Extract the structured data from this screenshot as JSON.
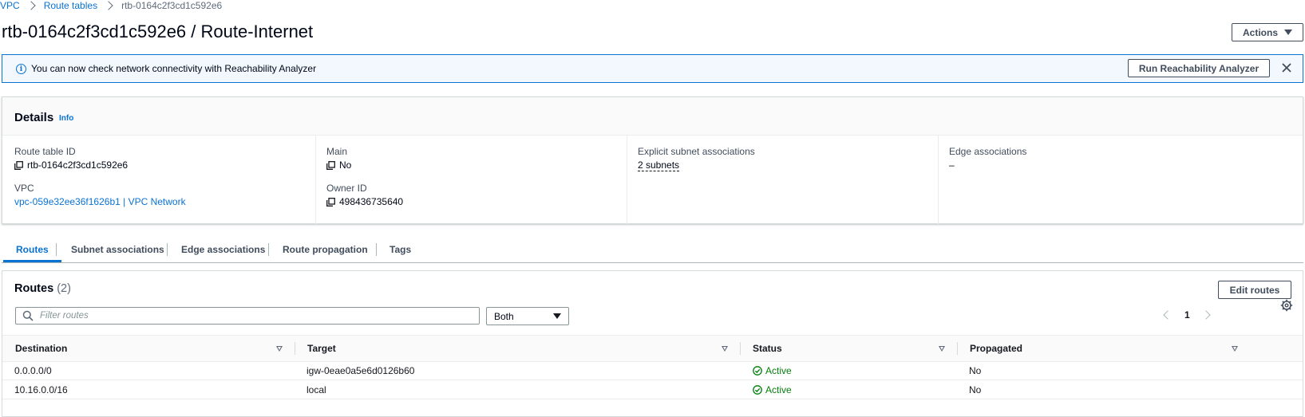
{
  "breadcrumb": {
    "items": [
      "VPC",
      "Route tables"
    ],
    "current": "rtb-0164c2f3cd1c592e6"
  },
  "page": {
    "title": "rtb-0164c2f3cd1c592e6 / Route-Internet",
    "actions_label": "Actions"
  },
  "alert": {
    "message": "You can now check network connectivity with Reachability Analyzer",
    "button_label": "Run Reachability Analyzer"
  },
  "details": {
    "title": "Details",
    "info_label": "Info",
    "fields": {
      "route_table_id": {
        "label": "Route table ID",
        "value": "rtb-0164c2f3cd1c592e6"
      },
      "vpc": {
        "label": "VPC",
        "value": "vpc-059e32ee36f1626b1 | VPC Network"
      },
      "main": {
        "label": "Main",
        "value": "No"
      },
      "owner_id": {
        "label": "Owner ID",
        "value": "498436735640"
      },
      "explicit_subnets": {
        "label": "Explicit subnet associations",
        "value": "2 subnets"
      },
      "edge_associations": {
        "label": "Edge associations",
        "value": "–"
      }
    }
  },
  "tabs": [
    {
      "label": "Routes",
      "active": true
    },
    {
      "label": "Subnet associations",
      "active": false
    },
    {
      "label": "Edge associations",
      "active": false
    },
    {
      "label": "Route propagation",
      "active": false
    },
    {
      "label": "Tags",
      "active": false
    }
  ],
  "routes": {
    "title": "Routes",
    "count": "(2)",
    "edit_label": "Edit routes",
    "filter_placeholder": "Filter routes",
    "select_value": "Both",
    "page_number": "1",
    "columns": [
      "Destination",
      "Target",
      "Status",
      "Propagated"
    ],
    "rows": [
      {
        "destination": "0.0.0.0/0",
        "target": "igw-0eae0a5e6d0126b60",
        "status": "Active",
        "propagated": "No"
      },
      {
        "destination": "10.16.0.0/16",
        "target": "local",
        "status": "Active",
        "propagated": "No"
      }
    ]
  },
  "colors": {
    "link": "#0972d3",
    "success": "#037f0c",
    "alert_bg": "#f2f8fd"
  }
}
